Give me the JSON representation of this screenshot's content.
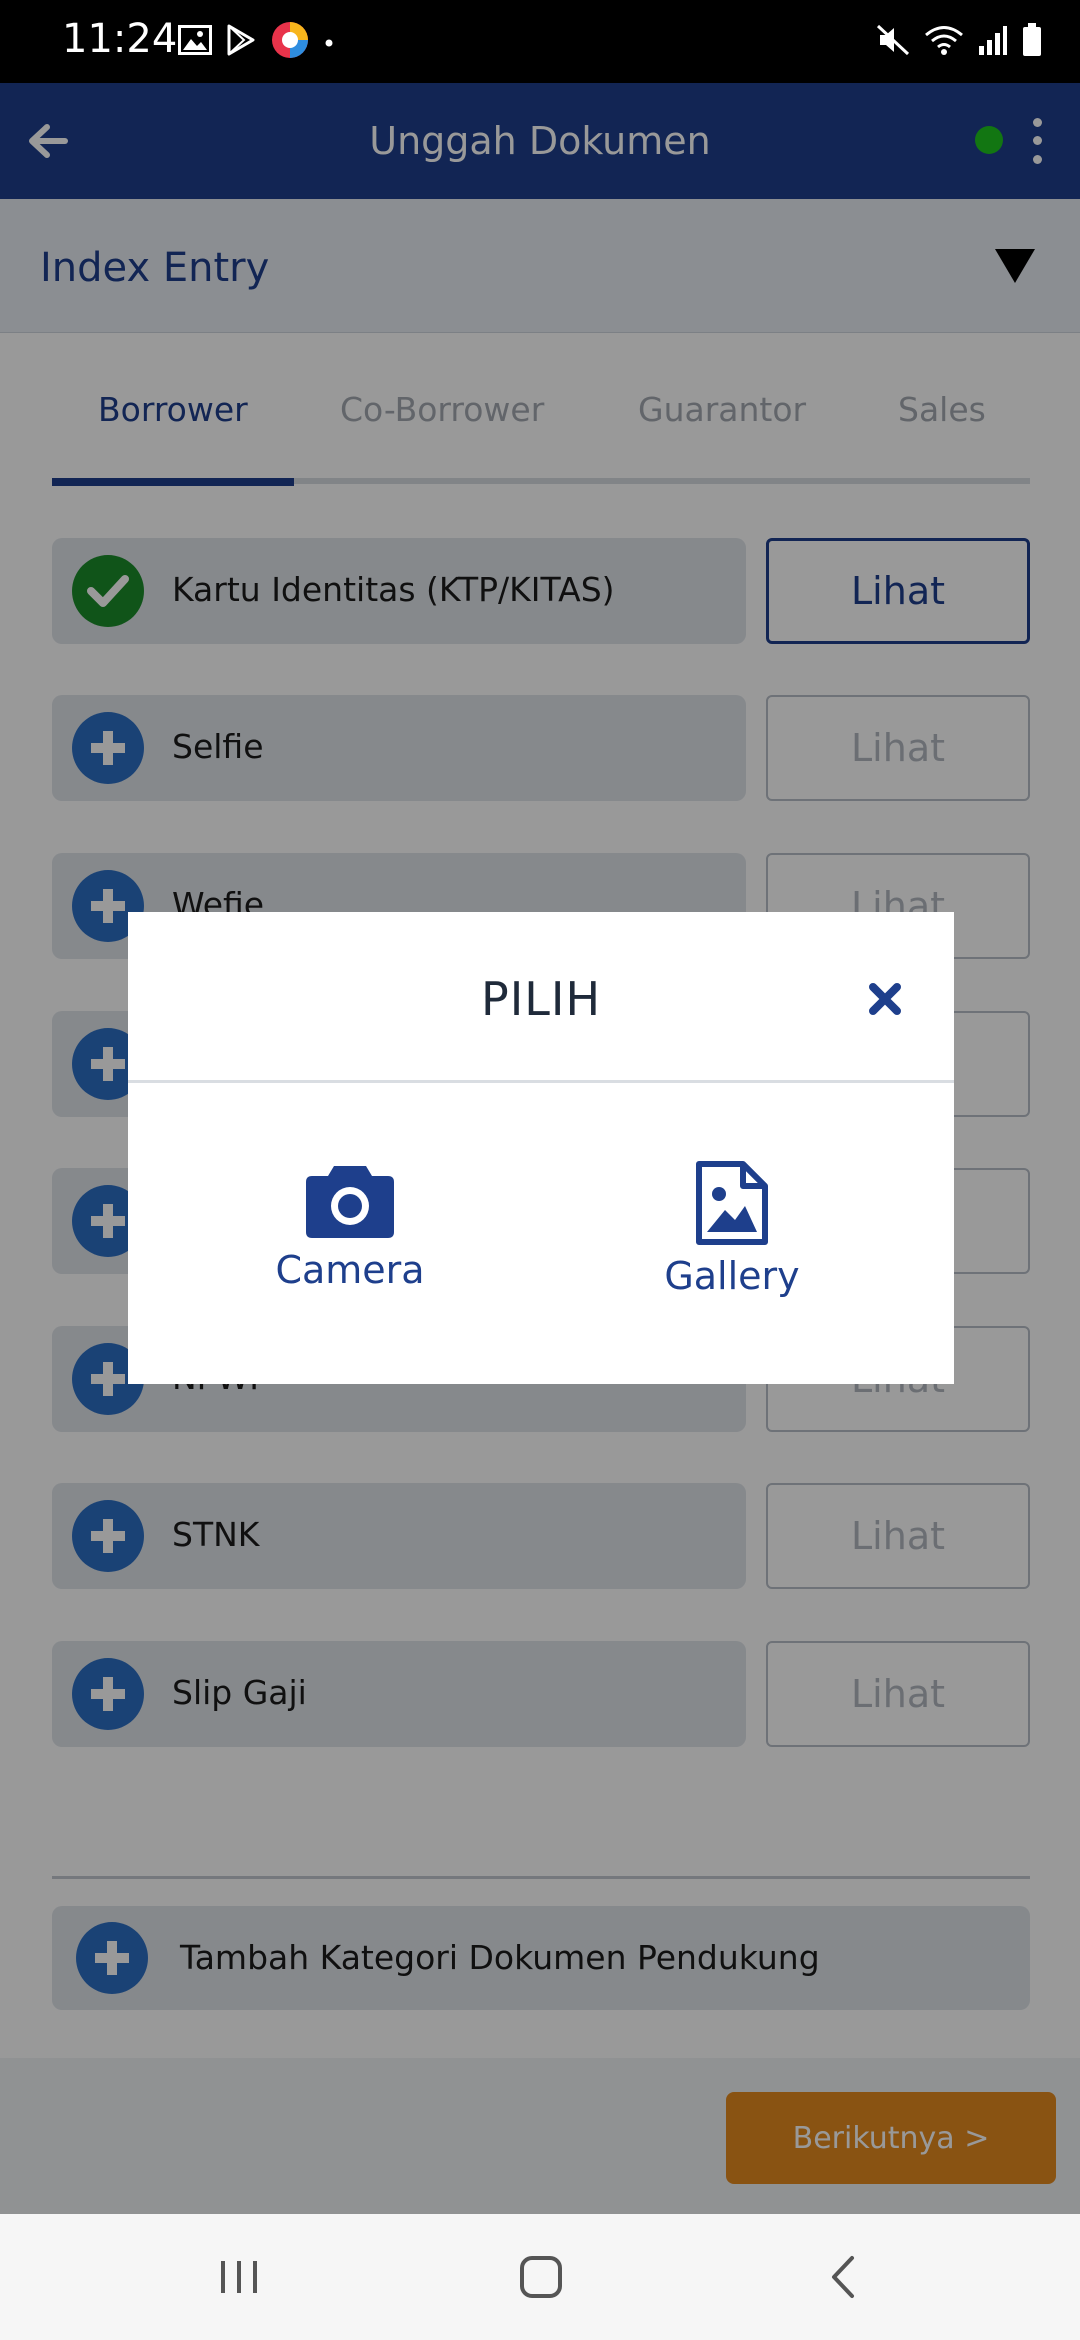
{
  "status_bar": {
    "time": "11:24",
    "left_icons": [
      "image-icon",
      "play-store-icon",
      "app-logo-icon",
      "dot-icon"
    ],
    "right_icons": [
      "mute-icon",
      "wifi-icon",
      "signal-icon",
      "battery-icon"
    ]
  },
  "app_bar": {
    "title": "Unggah Dokumen",
    "status_color": "#1fc51f"
  },
  "index_entry": {
    "label": "Index Entry"
  },
  "tabs": [
    {
      "label": "Borrower",
      "active": true
    },
    {
      "label": "Co-Borrower",
      "active": false
    },
    {
      "label": "Guarantor",
      "active": false
    },
    {
      "label": "Sales",
      "active": false
    }
  ],
  "documents": [
    {
      "label": "Kartu Identitas (KTP/KITAS)",
      "status": "uploaded",
      "button": "Lihat"
    },
    {
      "label": "Selfie",
      "status": "pending",
      "button": "Lihat"
    },
    {
      "label": "Wefie",
      "status": "pending",
      "button": "Lihat"
    },
    {
      "label": "",
      "status": "pending",
      "button": ""
    },
    {
      "label": "",
      "status": "pending",
      "button": ""
    },
    {
      "label": "NPWP",
      "status": "pending",
      "button": "Lihat"
    },
    {
      "label": "STNK",
      "status": "pending",
      "button": "Lihat"
    },
    {
      "label": "Slip Gaji",
      "status": "pending",
      "button": "Lihat"
    }
  ],
  "add_category": {
    "label": "Tambah Kategori Dokumen Pendukung"
  },
  "footer": {
    "next_label": "Berikutnya >"
  },
  "dialog": {
    "title": "PILIH",
    "options": [
      {
        "label": "Camera",
        "icon": "camera-icon"
      },
      {
        "label": "Gallery",
        "icon": "image-file-icon"
      }
    ]
  },
  "colors": {
    "primary": "#1e3f8c",
    "accent": "#e58a1f",
    "success": "#1c8c2b",
    "plus": "#2c6fc4"
  }
}
